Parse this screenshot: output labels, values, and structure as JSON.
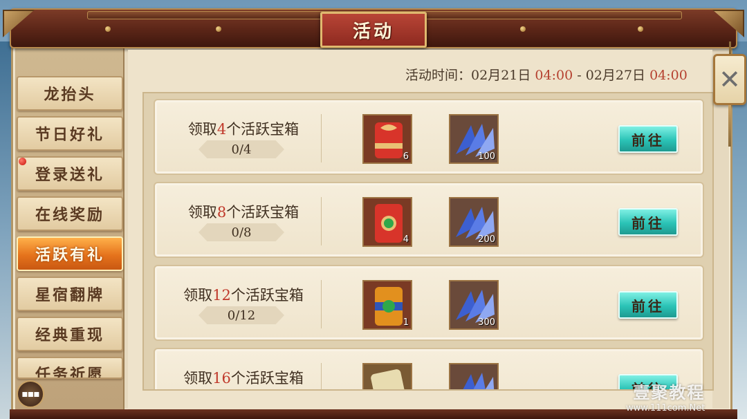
{
  "header": {
    "title": "活动"
  },
  "event_time": {
    "label": "活动时间：",
    "start_date": "02月21日",
    "start_time": "04:00",
    "separator": " - ",
    "end_date": "02月27日",
    "end_time": "04:00"
  },
  "sidebar": {
    "items": [
      {
        "label": "龙抬头",
        "active": false
      },
      {
        "label": "节日好礼",
        "active": false
      },
      {
        "label": "登录送礼",
        "active": false,
        "red_dot": true
      },
      {
        "label": "在线奖励",
        "active": false
      },
      {
        "label": "活跃有礼",
        "active": true
      },
      {
        "label": "星宿翻牌",
        "active": false
      },
      {
        "label": "经典重现",
        "active": false
      },
      {
        "label": "任务祈愿",
        "active": false
      }
    ]
  },
  "rewards": [
    {
      "prefix": "领取",
      "num": "4",
      "suffix": "个活跃宝箱",
      "progress": "0/4",
      "items": [
        {
          "icon": "red-scroll-icon",
          "count": "6"
        },
        {
          "icon": "blue-feather-icon",
          "count": "100"
        }
      ],
      "button": "前往"
    },
    {
      "prefix": "领取",
      "num": "8",
      "suffix": "个活跃宝箱",
      "progress": "0/8",
      "items": [
        {
          "icon": "red-jade-scroll-icon",
          "count": "4"
        },
        {
          "icon": "blue-feather-icon",
          "count": "200"
        }
      ],
      "button": "前往"
    },
    {
      "prefix": "领取",
      "num": "12",
      "suffix": "个活跃宝箱",
      "progress": "0/12",
      "items": [
        {
          "icon": "gold-jade-scroll-icon",
          "count": "1"
        },
        {
          "icon": "blue-feather-icon",
          "count": "300"
        }
      ],
      "button": "前往"
    },
    {
      "prefix": "领取",
      "num": "16",
      "suffix": "个活跃宝箱",
      "progress": "",
      "items": [
        {
          "icon": "paper-scroll-icon",
          "count": ""
        },
        {
          "icon": "blue-feather-icon",
          "count": ""
        }
      ],
      "button": "前往"
    }
  ],
  "close": {
    "icon": "close-icon"
  },
  "chat": {
    "icon": "chat-bubble-icon"
  },
  "watermark": {
    "title": "壹聚教程",
    "url": "www.111com.Net"
  },
  "colors": {
    "accent_red": "#b5402f",
    "active_orange": "#e5731c",
    "go_button": "#2bc3b6"
  }
}
